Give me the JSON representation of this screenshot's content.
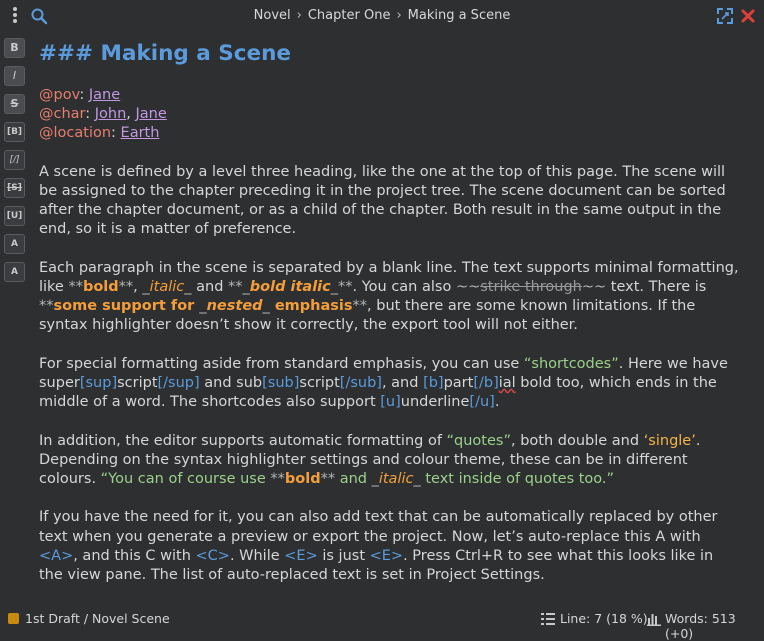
{
  "breadcrumb": {
    "items": [
      "Novel",
      "Chapter One",
      "Making a Scene"
    ],
    "separator": "›"
  },
  "toolbar": {
    "buttons": [
      {
        "name": "bold",
        "label": "B"
      },
      {
        "name": "italic",
        "label": "I"
      },
      {
        "name": "strikethrough",
        "label": "S"
      },
      {
        "name": "shortcode-bold",
        "label": "[B]"
      },
      {
        "name": "shortcode-italic",
        "label": "[/]"
      },
      {
        "name": "shortcode-strike",
        "label": "[S]"
      },
      {
        "name": "shortcode-underline",
        "label": "[U]"
      },
      {
        "name": "superscript",
        "label": "A"
      },
      {
        "name": "subscript",
        "label": "A"
      }
    ]
  },
  "doc": {
    "heading_marker": "###",
    "heading_text": "Making a Scene",
    "meta": {
      "pov_kw": "@pov",
      "pov_val": "Jane",
      "char_kw": "@char",
      "char_val1": "John",
      "char_val2": "Jane",
      "loc_kw": "@location",
      "loc_val": "Earth"
    },
    "p1": "A scene is defined by a level three heading, like the one at the top of this page. The scene will be assigned to the chapter preceding it in the project tree. The scene document can be sorted after the chapter document, or as a child of the chapter. Both result in the same output in the end, so it is a matter of preference.",
    "p2": {
      "a": "Each paragraph in the scene is separated by a blank line. The text supports minimal formatting, like ",
      "m1": "**",
      "bold": "bold",
      "m2": "**",
      "c1": ", ",
      "m3": "_",
      "italic": "italic",
      "m4": "_",
      "c2": " and ",
      "m5": "**_",
      "bolditalic": "bold italic",
      "m6": "_**",
      "c3": ". You can also ",
      "m7": "~~",
      "strike": "strike through",
      "m8": "~~",
      "c4": " text. There is ",
      "m9": "**",
      "s1": "some support for ",
      "m10": "_",
      "nested": "nested",
      "m11": "_",
      "s2": " emphasis",
      "m12": "**",
      "c5": ", but there are some known limitations. If the syntax highlighter doesn’t show it correctly, the export tool will not either."
    },
    "p3": {
      "a": "For special formatting aside from standard emphasis, you can use ",
      "q1": "“shortcodes”",
      "b": ". Here we have super",
      "sup_open": "[sup]",
      "sup_text": "script",
      "sup_close": "[/sup]",
      "c": " and sub",
      "sub_open": "[sub]",
      "sub_text": "script",
      "sub_close": "[/sub]",
      "d": ", and ",
      "b_open": "[b]",
      "b_text": "part",
      "b_close": "[/b]",
      "b_rest": "ial",
      "e": " bold too, which ends in the middle of a word. The shortcodes also support ",
      "u_open": "[u]",
      "u_text": "underline",
      "u_close": "[/u]",
      "f": "."
    },
    "p4": {
      "a": "In addition, the editor supports automatic formatting of ",
      "q1": "“quotes”",
      "b": ", both double and ",
      "q2": "‘single’",
      "c": ". Depending on the syntax highlighter settings and colour theme, these can be in different colours. ",
      "q3a": "“You can of course use ",
      "m1": "**",
      "bold": "bold",
      "m2": "**",
      "q3b": " and ",
      "m3": "_",
      "italic": "italic",
      "m4": "_",
      "q3c": " text inside of quotes too.”"
    },
    "p5": {
      "a": "If you have the need for it, you can also add text that can be automatically replaced by other text when you generate a preview or export the project. Now, let’s auto-replace this A with ",
      "r1": "<A>",
      "b": ", and this C with ",
      "r2": "<C>",
      "c": ". While ",
      "r3": "<E>",
      "d": " is just ",
      "r4": "<E>",
      "e": ". Press Ctrl+R to see what this looks like in the view pane. The list of auto-replaced text is set in Project Settings."
    }
  },
  "status": {
    "draft": "1st Draft / Novel Scene",
    "line": "Line: 7 (18 %)",
    "words": "Words: 513 (+0)",
    "status_color": "#c98a12"
  },
  "colors": {
    "heading": "#5b9bdc",
    "keyword": "#e77e6e",
    "value": "#c199e0",
    "emphasis": "#f39e3a",
    "quote": "#9bd18a",
    "close": "#e0403a"
  }
}
